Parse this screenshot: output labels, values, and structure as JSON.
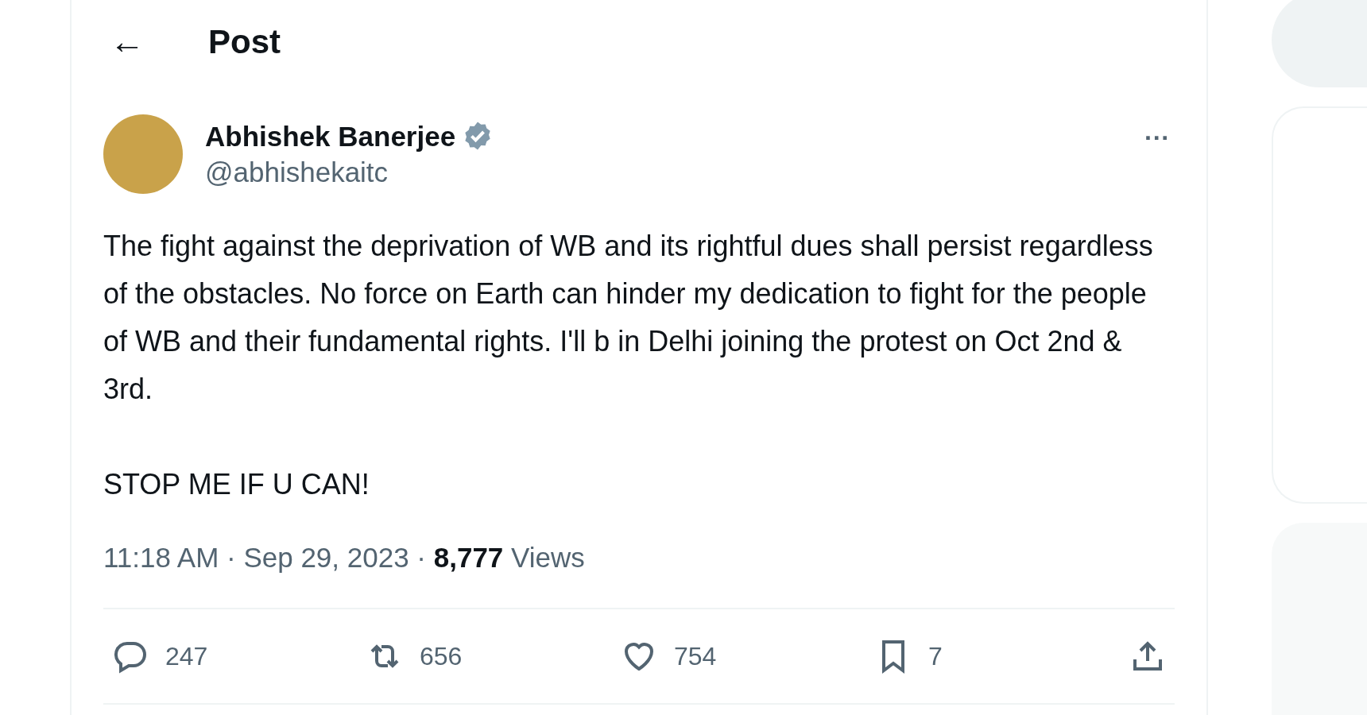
{
  "header": {
    "back_icon": "←",
    "title": "Post"
  },
  "author": {
    "name": "Abhishek Banerjee",
    "verified": true,
    "handle": "@abhishekaitc"
  },
  "more": "···",
  "body": "The fight against the deprivation of WB and its rightful dues shall persist regardless of the obstacles. No force on Earth can hinder my dedication to fight for the people of WB and their fundamental rights. I'll b in Delhi joining the protest on Oct 2nd & 3rd.\n\nSTOP ME IF U CAN!",
  "meta": "11:18 AM · Sep 29, 2023 · **8,777** Views",
  "actions": [
    {
      "kind": "reply",
      "count": "247"
    },
    {
      "kind": "repost",
      "count": "656"
    },
    {
      "kind": "like",
      "count": "754"
    },
    {
      "kind": "bookmark",
      "count": "7"
    },
    {
      "kind": "share"
    }
  ]
}
